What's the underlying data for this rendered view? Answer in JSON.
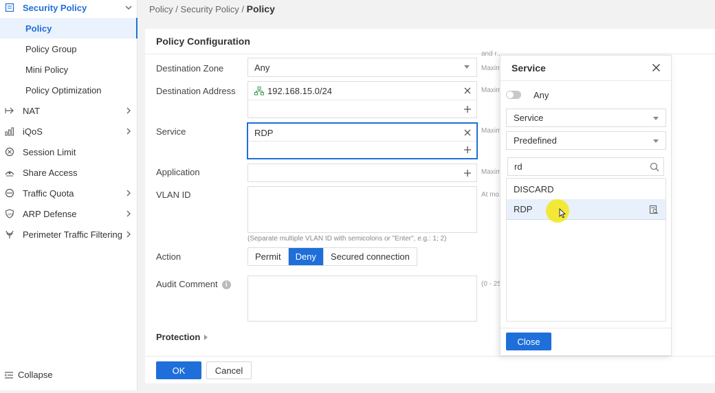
{
  "sidebar": {
    "items": [
      {
        "label": "Security Policy",
        "icon": "shield-list-icon"
      },
      {
        "label": "Policy"
      },
      {
        "label": "Policy Group"
      },
      {
        "label": "Mini Policy"
      },
      {
        "label": "Policy Optimization"
      },
      {
        "label": "NAT",
        "icon": "nat-arrow-icon"
      },
      {
        "label": "iQoS",
        "icon": "bar-chart-icon"
      },
      {
        "label": "Session Limit",
        "icon": "session-limit-icon"
      },
      {
        "label": "Share Access",
        "icon": "share-access-icon"
      },
      {
        "label": "Traffic Quota",
        "icon": "traffic-quota-icon"
      },
      {
        "label": "ARP Defense",
        "icon": "arp-defense-icon"
      },
      {
        "label": "Perimeter Traffic Filtering",
        "icon": "perimeter-filter-icon"
      }
    ],
    "collapse_label": "Collapse"
  },
  "breadcrumb": {
    "part1": "Policy",
    "sep": " / ",
    "part2": "Security Policy",
    "current": "Policy"
  },
  "form": {
    "title": "Policy Configuration",
    "destination_zone": {
      "label": "Destination Zone",
      "value": "Any"
    },
    "destination_address": {
      "label": "Destination Address",
      "value": "192.168.15.0/24"
    },
    "service": {
      "label": "Service",
      "value": "RDP"
    },
    "application": {
      "label": "Application"
    },
    "vlan_id": {
      "label": "VLAN ID",
      "note": "(Separate multiple VLAN ID with semicolons or \"Enter\", e.g.: 1; 2)"
    },
    "action": {
      "label": "Action",
      "options": [
        "Permit",
        "Deny",
        "Secured connection"
      ],
      "selected": "Deny"
    },
    "audit_comment": {
      "label": "Audit Comment"
    },
    "protection": {
      "label": "Protection"
    },
    "hints": {
      "top": "and r... ",
      "maxim": "Maxim",
      "at_mo": "At mo",
      "range": "(0 - 25"
    }
  },
  "buttons": {
    "ok": "OK",
    "cancel": "Cancel"
  },
  "service_popup": {
    "title": "Service",
    "any_label": "Any",
    "any_enabled": false,
    "type_select": "Service",
    "category_select": "Predefined",
    "search_value": "rd",
    "results": [
      "DISCARD",
      "RDP"
    ],
    "highlighted": "RDP",
    "close_label": "Close"
  },
  "colors": {
    "accent": "#1e6fd9",
    "highlight": "#e8f0fb",
    "cursor_halo": "#f5e614"
  }
}
